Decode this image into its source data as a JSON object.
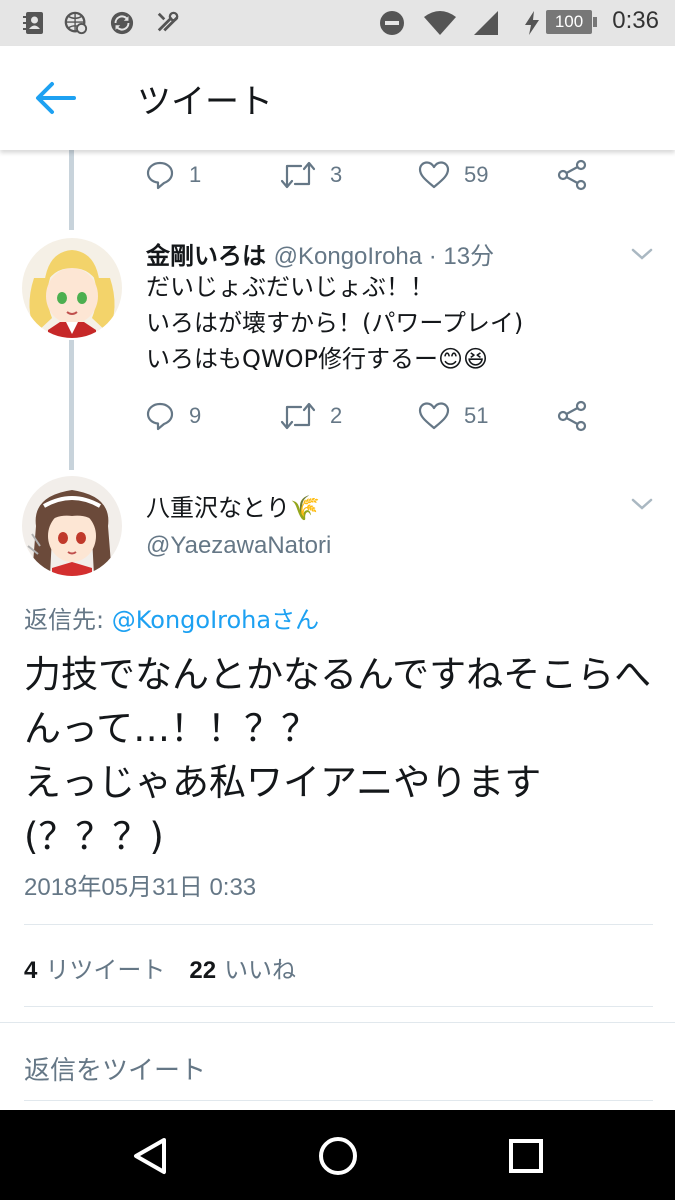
{
  "status_bar": {
    "time": "0:36",
    "battery": "100",
    "icons": [
      "contacts-icon",
      "wifi-search-icon",
      "sync-icon",
      "tools-icon",
      "do-not-disturb-icon",
      "wifi-icon",
      "signal-icon",
      "charging-icon"
    ]
  },
  "app_bar": {
    "title": "ツイート",
    "back_icon": "arrow-left-icon"
  },
  "prev_tweet_actions": {
    "replies": "1",
    "retweets": "3",
    "likes": "59"
  },
  "reply_tweet": {
    "name": "金剛いろは",
    "handle": "@KongoIroha · 13分",
    "text": "だいじょぶだいじょぶ！！\nいろはが壊すから！(パワープレイ)\nいろはもQWOP修行するー😊😆",
    "actions": {
      "replies": "9",
      "retweets": "2",
      "likes": "51"
    }
  },
  "main_tweet": {
    "name": "八重沢なとり🌾",
    "handle": "@YaezawaNatori",
    "reply_label": "返信先: ",
    "reply_target": "@KongoIrohaさん",
    "text": "力技でなんとかなるんですねそこらへんって…！！？？\nえっじゃあ私ワイアニやります(？？？)",
    "timestamp": "2018年05月31日 0:33",
    "retweet_count": "4",
    "retweet_label": "リツイート",
    "like_count": "22",
    "like_label": "いいね",
    "reply_placeholder": "返信をツイート"
  },
  "colors": {
    "accent": "#1da1f2",
    "secondary_text": "#657786",
    "thread_line": "#c8d3db"
  }
}
